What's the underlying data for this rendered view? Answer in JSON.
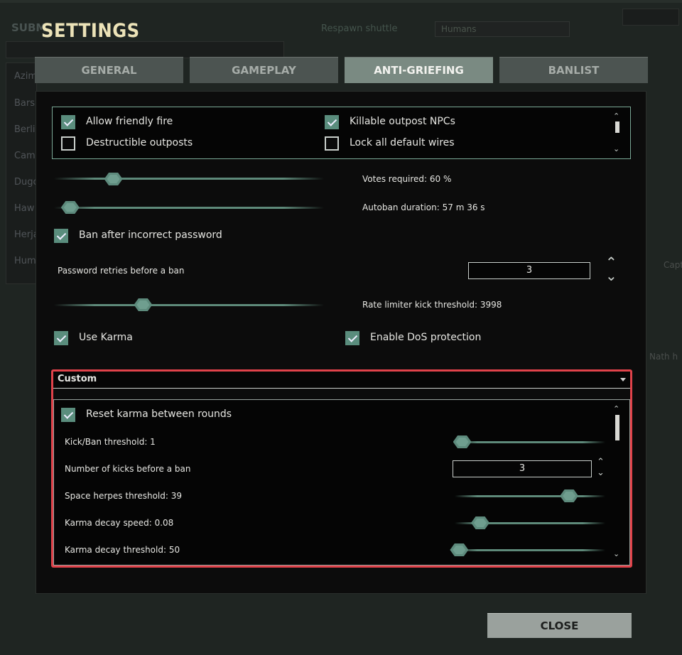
{
  "background": {
    "subm_label": "SUBM",
    "respawn_label": "Respawn shuttle",
    "combo_value": "Humans",
    "list_items": [
      "Azim",
      "Bars",
      "Berli",
      "Cam",
      "Dugo",
      "Haw",
      "Herja",
      "Hum"
    ],
    "right_texts": [
      "Capt",
      "Nath h"
    ]
  },
  "dialog": {
    "title": "SETTINGS",
    "tabs": [
      {
        "label": "GENERAL",
        "active": false
      },
      {
        "label": "GAMEPLAY",
        "active": false
      },
      {
        "label": "ANTI-GRIEFING",
        "active": true
      },
      {
        "label": "BANLIST",
        "active": false
      }
    ],
    "top_checkboxes": [
      {
        "label": "Allow friendly fire",
        "checked": true
      },
      {
        "label": "Killable outpost NPCs",
        "checked": true
      },
      {
        "label": "Destructible outposts",
        "checked": false
      },
      {
        "label": "Lock all default wires",
        "checked": false
      }
    ],
    "votes_required": {
      "label": "Votes required: 60 %",
      "value_fraction": 0.22
    },
    "autoban_duration": {
      "label": "Autoban duration: 57 m 36 s",
      "value_fraction": 0.06
    },
    "ban_after_incorrect_password": {
      "label": "Ban after incorrect password",
      "checked": true
    },
    "password_retries": {
      "label": "Password retries before a ban",
      "value": "3"
    },
    "rate_limiter": {
      "label": "Rate limiter kick threshold: 3998",
      "value_fraction": 0.33
    },
    "use_karma": {
      "label": "Use Karma",
      "checked": true
    },
    "enable_dos": {
      "label": "Enable DoS protection",
      "checked": true
    },
    "karma_preset": {
      "value": "Custom"
    },
    "karma": {
      "reset_between_rounds": {
        "label": "Reset karma between rounds",
        "checked": true
      },
      "kick_ban_threshold": {
        "label": "Kick/Ban threshold: 1",
        "value_fraction": 0.05
      },
      "kicks_before_ban": {
        "label": "Number of kicks before a ban",
        "value": "3"
      },
      "space_herpes_threshold": {
        "label": "Space herpes threshold: 39",
        "value_fraction": 0.76
      },
      "karma_decay_speed": {
        "label": "Karma decay speed: 0.08",
        "value_fraction": 0.17
      },
      "karma_decay_threshold": {
        "label": "Karma decay threshold: 50",
        "value_fraction": 0.03
      }
    },
    "close_label": "CLOSE"
  },
  "colors": {
    "accent": "#5a8d7d",
    "highlight_border": "#e0424a",
    "title": "#ece3b8"
  }
}
